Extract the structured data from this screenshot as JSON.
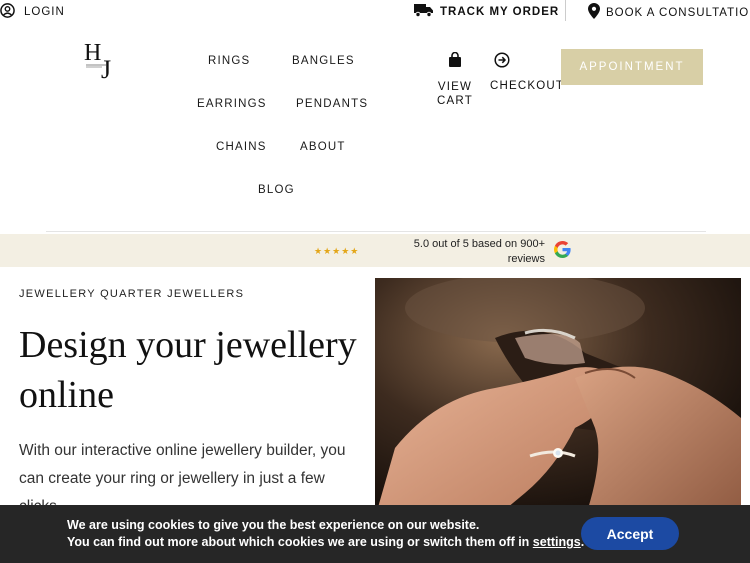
{
  "topbar": {
    "login_label": "LOGIN",
    "track_label": "TRACK MY ORDER",
    "book_label": "BOOK A CONSULTATION"
  },
  "header": {
    "logo_text": "HJ",
    "nav": [
      "RINGS",
      "BANGLES",
      "EARRINGS",
      "PENDANTS",
      "CHAINS",
      "ABOUT",
      "BLOG"
    ],
    "cart_line1": "VIEW",
    "cart_line2": "CART",
    "checkout_label": "CHECKOUT",
    "appointment_label": "APPOINTMENT"
  },
  "rating": {
    "stars": "★★★★★",
    "line1": "5.0 out of 5 based on 900+",
    "line2": "reviews",
    "star_color": "#e3a619"
  },
  "hero": {
    "eyebrow": "JEWELLERY QUARTER JEWELLERS",
    "title": "Design your jewellery online",
    "body": "With our interactive online jewellery builder, you can create your ring or jewellery in just a few clicks."
  },
  "cookie": {
    "line1": "We are using cookies to give you the best experience on our website.",
    "line2_pre": "You can find out more about which cookies we are using or switch them off in ",
    "settings_link": "settings",
    "line2_post": ".",
    "accept_label": "Accept",
    "accept_color": "#1c4aa3"
  },
  "colors": {
    "accent": "#d8cfa6",
    "band": "#f3efe3",
    "cookie_bg": "#262626"
  }
}
